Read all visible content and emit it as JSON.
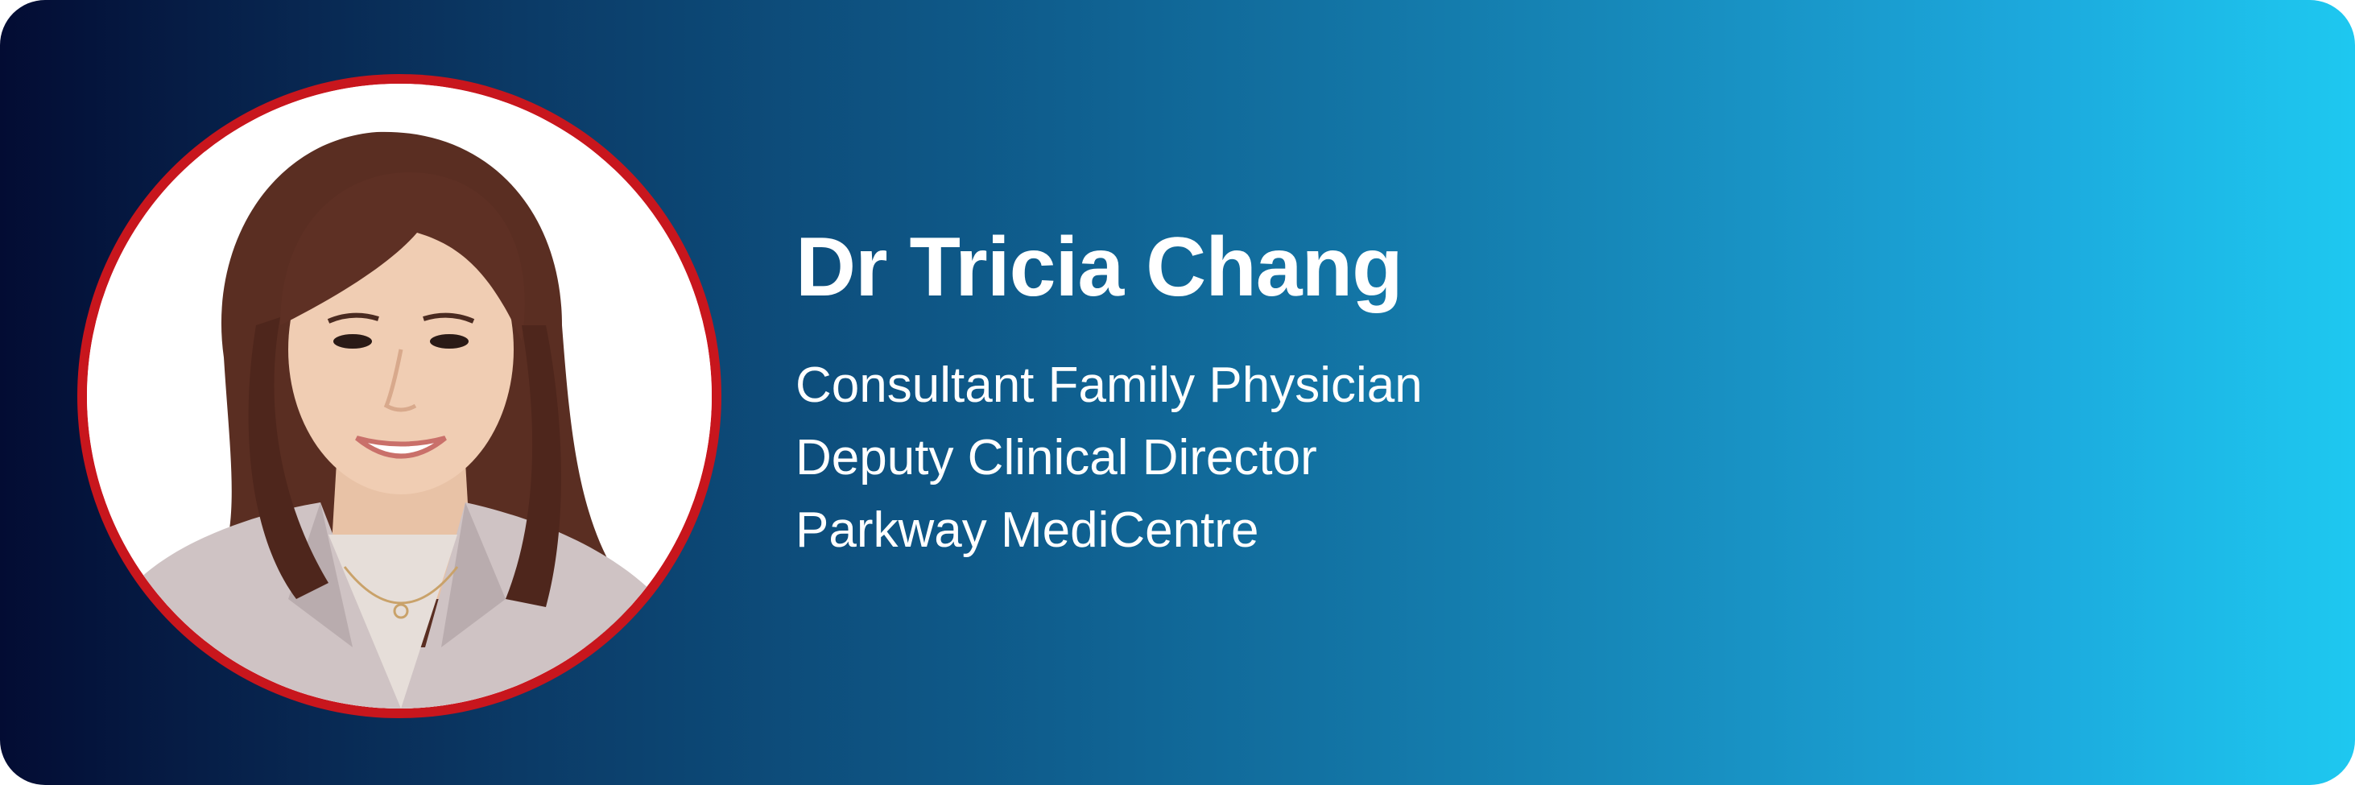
{
  "profile": {
    "name": "Dr Tricia Chang",
    "details": [
      "Consultant Family Physician",
      "Deputy Clinical Director",
      "Parkway MediCentre"
    ],
    "photo_alt": "portrait-photo"
  },
  "colors": {
    "gradient_start": "#030c33",
    "gradient_end": "#1ec8f0",
    "photo_border": "#c8161d",
    "photo_background": "#ffffff",
    "text": "#ffffff"
  }
}
